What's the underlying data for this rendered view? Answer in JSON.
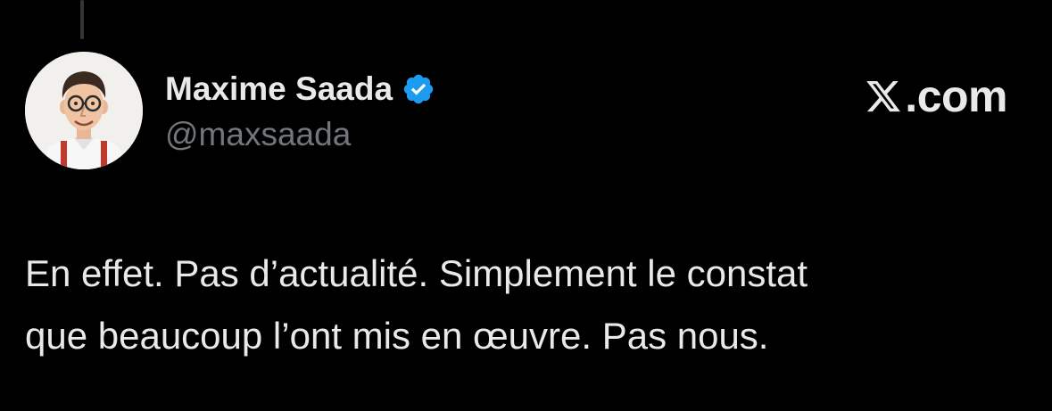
{
  "tweet": {
    "author": {
      "name": "Maxime Saada",
      "handle": "@maxsaada",
      "verified": true,
      "avatar_icon": "caricature-portrait-avatar"
    },
    "brand": {
      "logo_icon": "x-logo-icon",
      "text": ".com"
    },
    "text_lines": [
      "En effet. Pas d’actualité. Simplement le constat",
      "que beaucoup l’ont mis en œuvre. Pas nous."
    ]
  },
  "colors": {
    "background": "#000000",
    "primary_text": "#e7e9ea",
    "secondary_text": "#71767b",
    "verified_badge": "#1d9bf0",
    "thread_line": "#333639"
  }
}
